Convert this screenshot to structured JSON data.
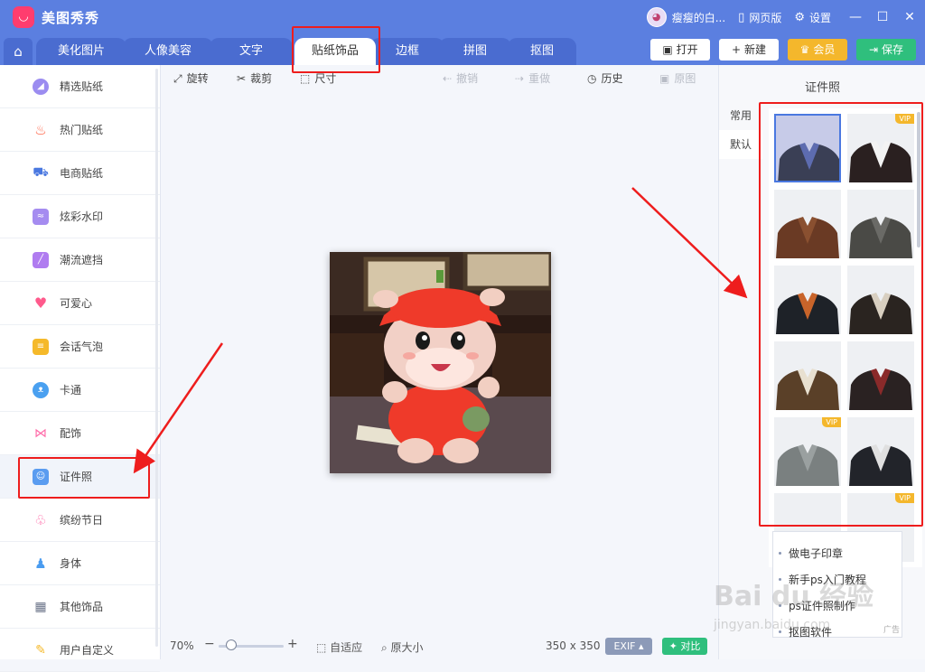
{
  "app": {
    "title": "美图秀秀",
    "logo_glyph": "◡"
  },
  "titlebar": {
    "username": "瘦瘦的白...",
    "web_version": "网页版",
    "settings": "设置",
    "minimize": "—",
    "maximize": "☐",
    "close": "✕"
  },
  "tabs": [
    "美化图片",
    "人像美容",
    "文字",
    "贴纸饰品",
    "边框",
    "拼图",
    "抠图"
  ],
  "active_tab": "贴纸饰品",
  "top_buttons": {
    "open": "打开",
    "new": "新建",
    "vip": "会员",
    "save": "保存"
  },
  "sidebar": {
    "items": [
      {
        "label": "精选贴纸",
        "icon": "sticker-icon",
        "color": "#9b8cf0"
      },
      {
        "label": "热门贴纸",
        "icon": "fire-icon",
        "color": "#ff5a3c"
      },
      {
        "label": "电商贴纸",
        "icon": "cart-icon",
        "color": "#4a78e0"
      },
      {
        "label": "炫彩水印",
        "icon": "watermark-icon",
        "color": "#a58cf0"
      },
      {
        "label": "潮流遮挡",
        "icon": "mask-icon",
        "color": "#b07cf0"
      },
      {
        "label": "可爱心",
        "icon": "heart-icon",
        "color": "#ff5a8c"
      },
      {
        "label": "会话气泡",
        "icon": "bubble-icon",
        "color": "#f5b92a"
      },
      {
        "label": "卡通",
        "icon": "bear-icon",
        "color": "#4aa0f0"
      },
      {
        "label": "配饰",
        "icon": "bow-icon",
        "color": "#ff6aa8"
      },
      {
        "label": "证件照",
        "icon": "id-photo-icon",
        "color": "#5a9cf0"
      },
      {
        "label": "缤纷节日",
        "icon": "balloon-icon",
        "color": "#ff6aa8"
      },
      {
        "label": "身体",
        "icon": "person-icon",
        "color": "#4a9cf0"
      },
      {
        "label": "其他饰品",
        "icon": "grid-icon",
        "color": "#6a7388"
      },
      {
        "label": "用户自定义",
        "icon": "pencil-icon",
        "color": "#f5b92a"
      }
    ],
    "selected": "证件照"
  },
  "toolbar": {
    "rotate": "旋转",
    "crop": "裁剪",
    "size": "尺寸",
    "undo": "撤销",
    "redo": "重做",
    "history": "历史",
    "original": "原图"
  },
  "bottombar": {
    "zoom": "70%",
    "fit": "自适应",
    "actual_size": "原大小",
    "dimensions": "350 x 350",
    "exif": "EXIF",
    "compare": "对比"
  },
  "right_panel": {
    "title": "证件照",
    "categories": [
      "常用",
      "默认"
    ],
    "selected_category": "默认",
    "vip_label": "VIP",
    "thumbs": [
      {
        "name": "suit-1",
        "vip": false,
        "color": "#3a3f55",
        "shirt": "#5d6cb0"
      },
      {
        "name": "suit-2",
        "vip": true,
        "color": "#2a2020",
        "shirt": "#f3f3f3"
      },
      {
        "name": "suit-3",
        "vip": false,
        "color": "#6a3a24",
        "shirt": "#8a5030"
      },
      {
        "name": "suit-4",
        "vip": false,
        "color": "#4a4a46",
        "shirt": "#6a6a66"
      },
      {
        "name": "suit-5",
        "vip": false,
        "color": "#1e2228",
        "shirt": "#c8642a"
      },
      {
        "name": "suit-6",
        "vip": false,
        "color": "#2a2420",
        "shirt": "#d8cfc0"
      },
      {
        "name": "suit-7",
        "vip": false,
        "color": "#5a4028",
        "shirt": "#e8e0d0"
      },
      {
        "name": "suit-8",
        "vip": false,
        "color": "#2a2222",
        "shirt": "#8a2a2a"
      },
      {
        "name": "suit-9",
        "vip": true,
        "color": "#7a8080",
        "shirt": "#9aa0a0"
      },
      {
        "name": "suit-10",
        "vip": false,
        "color": "#22242a",
        "shirt": "#e0e0e0"
      },
      {
        "name": "suit-11",
        "vip": false,
        "color": "#e6e8ec",
        "shirt": "#e6e8ec"
      },
      {
        "name": "suit-12",
        "vip": true,
        "color": "#e6e8ec",
        "shirt": "#e6e8ec"
      }
    ]
  },
  "links": [
    "做电子印章",
    "新手ps入门教程",
    "ps证件照制作",
    "抠图软件"
  ],
  "watermark": {
    "brand": "Bai du 经验",
    "url": "jingyan.baidu.com",
    "ad": "广告"
  },
  "colors": {
    "accent": "#5b7fe0",
    "tab_dark": "#4a6cd0",
    "highlight": "#ee1d1d"
  }
}
